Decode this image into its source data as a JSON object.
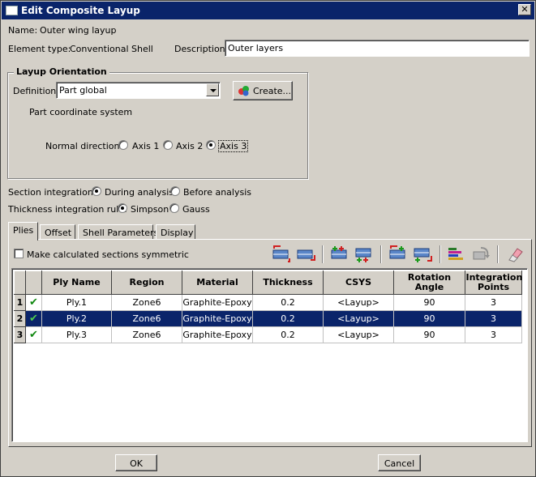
{
  "window": {
    "title": "Edit Composite Layup",
    "close_glyph": "✕"
  },
  "name": {
    "label": "Name:",
    "value": "Outer wing layup"
  },
  "element_type": {
    "label": "Element type:",
    "value": "Conventional Shell"
  },
  "description": {
    "label": "Description:",
    "value": "Outer layers"
  },
  "layup_orientation": {
    "title": "Layup Orientation",
    "definition_label": "Definition:",
    "definition_value": "Part global",
    "create_button": "Create...",
    "coord_text": "Part coordinate system",
    "normal_label": "Normal direction:",
    "axes": [
      {
        "label": "Axis 1",
        "selected": false
      },
      {
        "label": "Axis 2",
        "selected": false
      },
      {
        "label": "Axis 3",
        "selected": true
      }
    ]
  },
  "section_integration": {
    "label": "Section integration:",
    "options": [
      {
        "label": "During analysis",
        "selected": true
      },
      {
        "label": "Before analysis",
        "selected": false
      }
    ]
  },
  "thickness_rule": {
    "label": "Thickness integration rule:",
    "options": [
      {
        "label": "Simpson",
        "selected": true
      },
      {
        "label": "Gauss",
        "selected": false
      }
    ]
  },
  "tabs": [
    {
      "label": "Plies",
      "active": true
    },
    {
      "label": "Offset",
      "active": false
    },
    {
      "label": "Shell Parameters",
      "active": false
    },
    {
      "label": "Display",
      "active": false
    }
  ],
  "symmetric_checkbox": {
    "label": "Make calculated sections symmetric",
    "checked": false
  },
  "toolbar_icons": [
    "insert-row-before-icon",
    "insert-row-after-icon",
    "copy-row-before-icon",
    "copy-row-after-icon",
    "paste-row-before-icon",
    "paste-row-after-icon",
    "ply-stack-plot-icon",
    "reverse-order-icon",
    "eraser-icon"
  ],
  "table": {
    "headers": [
      "Ply Name",
      "Region",
      "Material",
      "Thickness",
      "CSYS",
      "Rotation Angle",
      "Integration Points"
    ],
    "rows": [
      {
        "num": "1",
        "check": "✔",
        "cells": [
          "Ply.1",
          "Zone6",
          "Graphite-Epoxy",
          "0.2",
          "<Layup>",
          "90",
          "3"
        ],
        "selected": false
      },
      {
        "num": "2",
        "check": "✔",
        "cells": [
          "Ply.2",
          "Zone6",
          "Graphite-Epoxy",
          "0.2",
          "<Layup>",
          "90",
          "3"
        ],
        "selected": true
      },
      {
        "num": "3",
        "check": "✔",
        "cells": [
          "Ply.3",
          "Zone6",
          "Graphite-Epoxy",
          "0.2",
          "<Layup>",
          "90",
          "3"
        ],
        "selected": false
      }
    ]
  },
  "buttons": {
    "ok": "OK",
    "cancel": "Cancel"
  },
  "colors": {
    "selection": "#0a246a",
    "check": "#118811",
    "dialog": "#d4d0c8"
  }
}
